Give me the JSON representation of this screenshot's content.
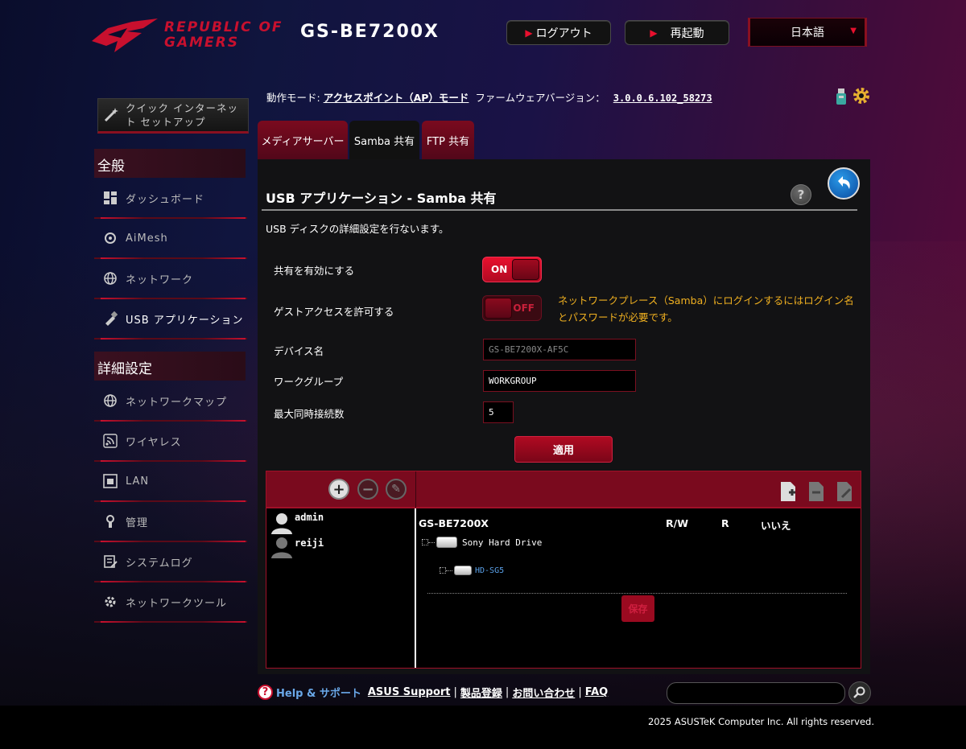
{
  "header": {
    "logo_line1": "REPUBLIC OF",
    "logo_line2": "GAMERS",
    "model": "GS-BE7200X",
    "logout_label": "ログアウト",
    "reboot_label": "再起動",
    "language": "日本語"
  },
  "sidebar": {
    "quick_setup": "クイック インターネット セットアップ",
    "section_general": "全般",
    "general_items": [
      {
        "label": "ダッシュボード"
      },
      {
        "label": "AiMesh"
      },
      {
        "label": "ネットワーク"
      },
      {
        "label": "USB アプリケーション"
      }
    ],
    "section_advanced": "詳細設定",
    "advanced_items": [
      {
        "label": "ネットワークマップ"
      },
      {
        "label": "ワイヤレス"
      },
      {
        "label": "LAN"
      },
      {
        "label": "管理"
      },
      {
        "label": "システムログ"
      },
      {
        "label": "ネットワークツール"
      }
    ]
  },
  "status": {
    "mode_label": "動作モード:",
    "mode_value": "アクセスポイント（AP）モード",
    "fw_label": "ファームウェアバージョン：",
    "fw_value": "3.0.0.6.102_58273"
  },
  "tabs": [
    {
      "label": "メディアサーバー"
    },
    {
      "label": "Samba 共有"
    },
    {
      "label": "FTP 共有"
    }
  ],
  "main": {
    "title": "USB アプリケーション - Samba 共有",
    "description": "USB ディスクの詳細設定を行ないます。",
    "enable_share_label": "共有を有効にする",
    "enable_share_state": "ON",
    "guest_access_label": "ゲストアクセスを許可する",
    "guest_access_state": "OFF",
    "guest_note": "ネットワークプレース（Samba）にログインするにはログイン名とパスワードが必要です。",
    "device_name_label": "デバイス名",
    "device_name_value": "GS-BE7200X-AF5C",
    "workgroup_label": "ワークグループ",
    "workgroup_value": "WORKGROUP",
    "max_conn_label": "最大同時接続数",
    "max_conn_value": "5",
    "apply_label": "適用"
  },
  "share_table": {
    "users": [
      {
        "name": "admin"
      },
      {
        "name": "reiji"
      }
    ],
    "root": "GS-BE7200X",
    "columns": [
      "R/W",
      "R",
      "いいえ"
    ],
    "drive": "Sony Hard Drive",
    "folder": "HD-SG5",
    "save_label": "保存"
  },
  "footer": {
    "help_label": "Help & サポート",
    "links": [
      "ASUS Support",
      "製品登録",
      "お問い合わせ",
      "FAQ"
    ],
    "copyright": "2025 ASUSTeK Computer Inc. All rights reserved."
  },
  "colors": {
    "accent": "#c8102e",
    "note": "#f0b020",
    "link": "#5aa0e8"
  }
}
